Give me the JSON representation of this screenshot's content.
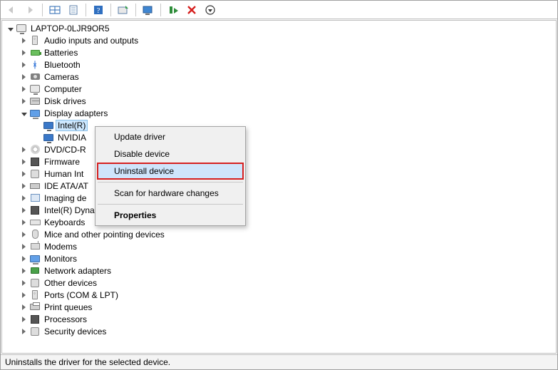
{
  "root_label": "LAPTOP-0LJR9OR5",
  "categories": [
    {
      "label": "Audio inputs and outputs",
      "expanded": false,
      "icon": "ic-port"
    },
    {
      "label": "Batteries",
      "expanded": false,
      "icon": "ic-batt"
    },
    {
      "label": "Bluetooth",
      "expanded": false,
      "icon": "ic-bt",
      "glyph": "ᚼ"
    },
    {
      "label": "Cameras",
      "expanded": false,
      "icon": "ic-cam"
    },
    {
      "label": "Computer",
      "expanded": false,
      "icon": "ic-comp"
    },
    {
      "label": "Disk drives",
      "expanded": false,
      "icon": "ic-disk"
    },
    {
      "label": "Display adapters",
      "expanded": true,
      "icon": "ic-mon",
      "children": [
        {
          "label": "Intel(R)",
          "selected": true,
          "icon": "ic-disp"
        },
        {
          "label": "NVIDIA",
          "selected": false,
          "icon": "ic-disp"
        }
      ]
    },
    {
      "label": "DVD/CD-R",
      "truncated": true,
      "expanded": false,
      "icon": "ic-cd"
    },
    {
      "label": "Firmware",
      "expanded": false,
      "icon": "ic-chip"
    },
    {
      "label": "Human Int",
      "truncated": true,
      "expanded": false,
      "icon": "ic-other"
    },
    {
      "label": "IDE ATA/AT",
      "truncated": true,
      "expanded": false,
      "icon": "ic-ide"
    },
    {
      "label": "Imaging de",
      "truncated": true,
      "expanded": false,
      "icon": "ic-img"
    },
    {
      "label": "Intel(R) Dynamic Platform and Thermal Framework",
      "expanded": false,
      "icon": "ic-chip"
    },
    {
      "label": "Keyboards",
      "expanded": false,
      "icon": "ic-keyb"
    },
    {
      "label": "Mice and other pointing devices",
      "expanded": false,
      "icon": "ic-mouse"
    },
    {
      "label": "Modems",
      "expanded": false,
      "icon": "ic-modem"
    },
    {
      "label": "Monitors",
      "expanded": false,
      "icon": "ic-mon"
    },
    {
      "label": "Network adapters",
      "expanded": false,
      "icon": "ic-net"
    },
    {
      "label": "Other devices",
      "expanded": false,
      "icon": "ic-other"
    },
    {
      "label": "Ports (COM & LPT)",
      "expanded": false,
      "icon": "ic-port"
    },
    {
      "label": "Print queues",
      "expanded": false,
      "icon": "ic-print"
    },
    {
      "label": "Processors",
      "expanded": false,
      "icon": "ic-chip"
    },
    {
      "label": "Security devices",
      "expanded": false,
      "icon": "ic-other"
    }
  ],
  "context_menu": {
    "items": [
      {
        "label": "Update driver"
      },
      {
        "label": "Disable device"
      },
      {
        "label": "Uninstall device",
        "highlighted": true
      },
      {
        "sep": true
      },
      {
        "label": "Scan for hardware changes"
      },
      {
        "sep": true
      },
      {
        "label": "Properties",
        "bold": true
      }
    ]
  },
  "statusbar_text": "Uninstalls the driver for the selected device.",
  "toolbar_icons": [
    "back-icon",
    "forward-icon",
    "sep",
    "show-hidden-icon",
    "properties-icon",
    "sep",
    "help-icon",
    "sep",
    "update-driver-icon",
    "sep",
    "monitor-icon",
    "sep",
    "add-hardware-icon",
    "remove-icon",
    "refresh-icon"
  ]
}
